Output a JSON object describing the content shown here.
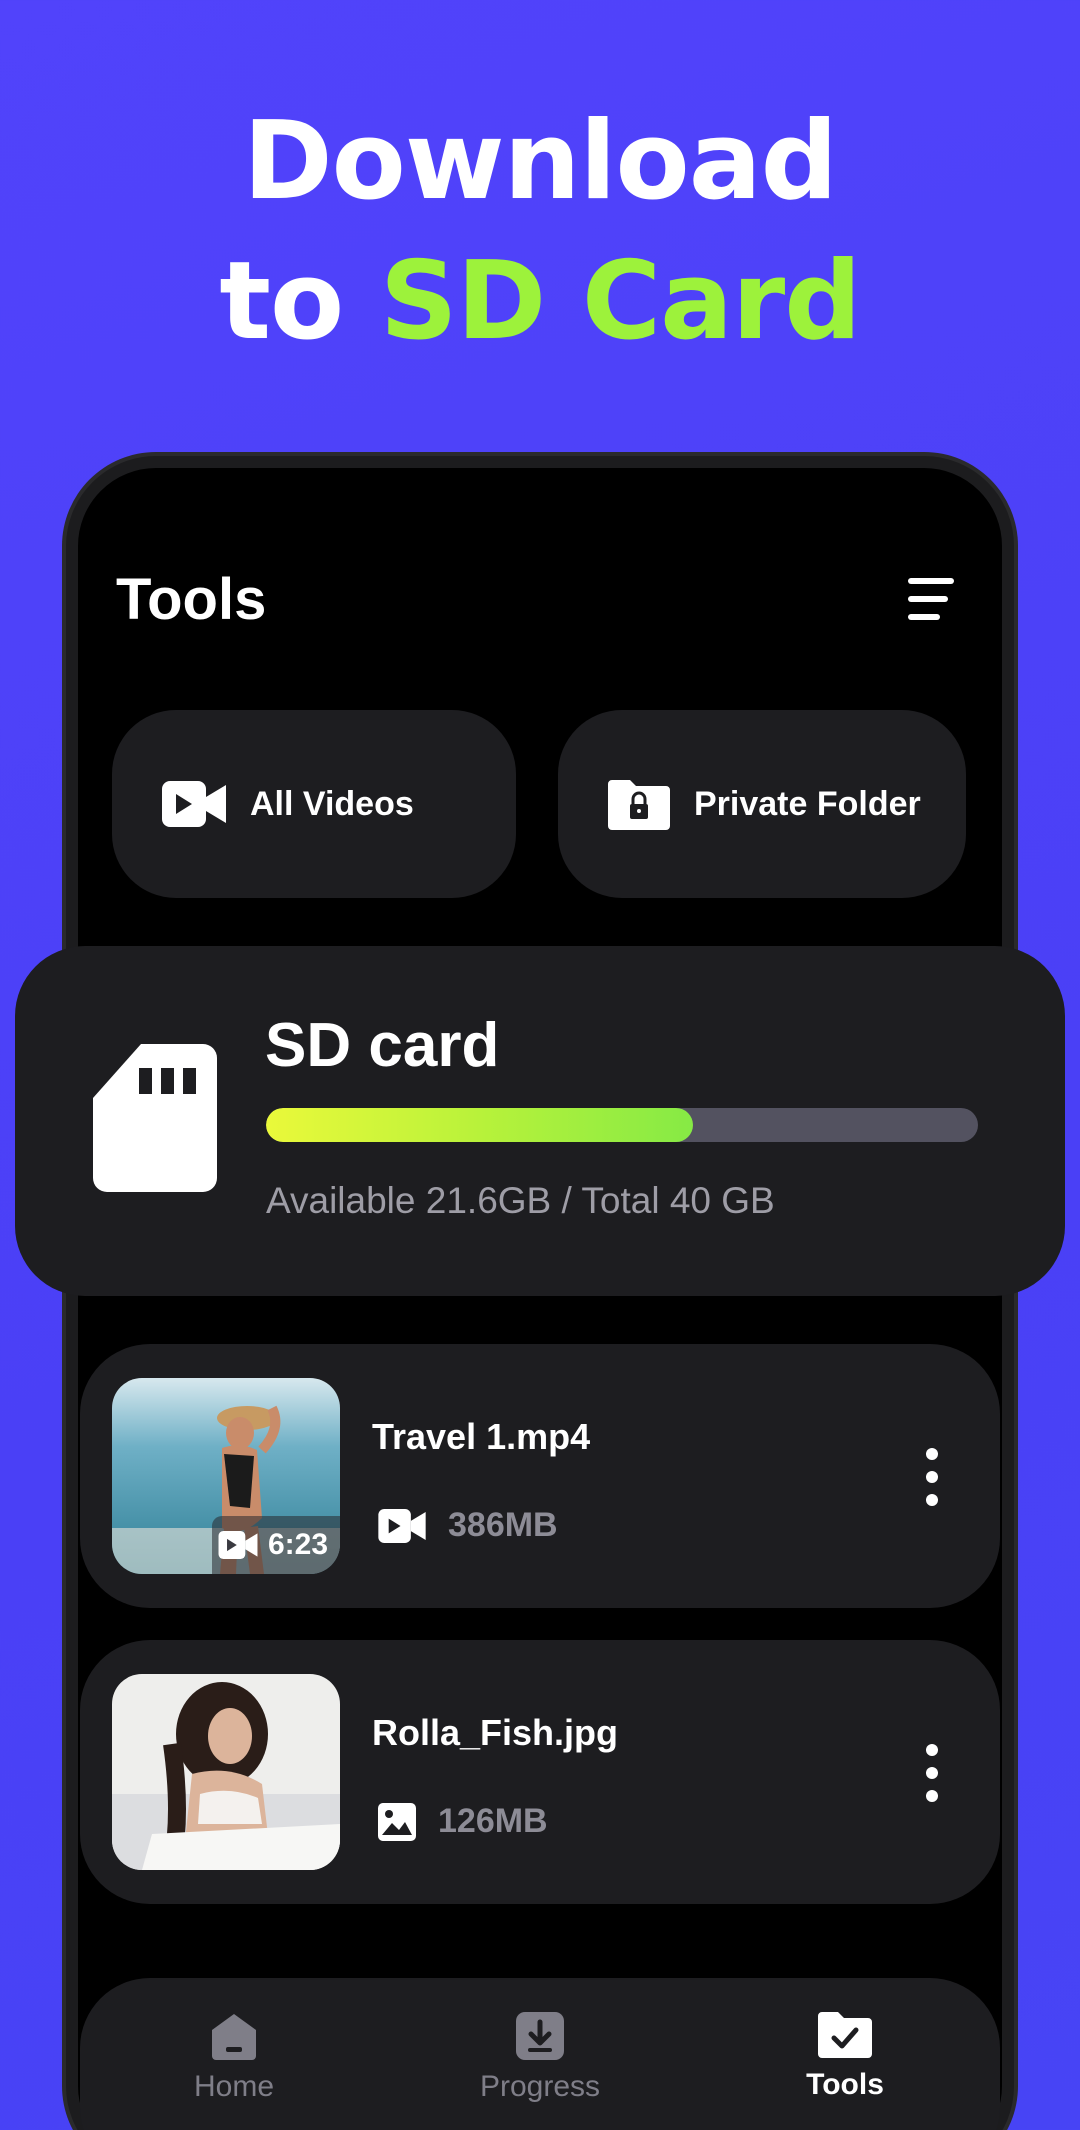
{
  "promo": {
    "line1": "Download",
    "line2_prefix": "to ",
    "line2_accent": "SD Card"
  },
  "colors": {
    "background": "#4b42f6",
    "accent": "#9df23b",
    "card": "#1d1d20",
    "muted_text": "#9e9da6"
  },
  "header": {
    "title": "Tools",
    "menu_icon": "hamburger-menu-icon"
  },
  "tools": [
    {
      "label": "All Videos",
      "icon": "video-camera-icon"
    },
    {
      "label": "Private Folder",
      "icon": "locked-folder-icon"
    }
  ],
  "sd_card": {
    "title": "SD card",
    "info": "Available 21.6GB / Total 40 GB",
    "used_fraction": 0.6,
    "icon": "sd-card-icon"
  },
  "files": [
    {
      "name": "Travel 1.mp4",
      "size": "386MB",
      "duration": "6:23",
      "type_icon": "video-camera-icon"
    },
    {
      "name": "Rolla_Fish.jpg",
      "size": "126MB",
      "type_icon": "image-icon"
    }
  ],
  "tabs": [
    {
      "label": "Home",
      "icon": "home-icon",
      "active": false
    },
    {
      "label": "Progress",
      "icon": "download-icon",
      "active": false
    },
    {
      "label": "Tools",
      "icon": "folder-check-icon",
      "active": true
    }
  ]
}
